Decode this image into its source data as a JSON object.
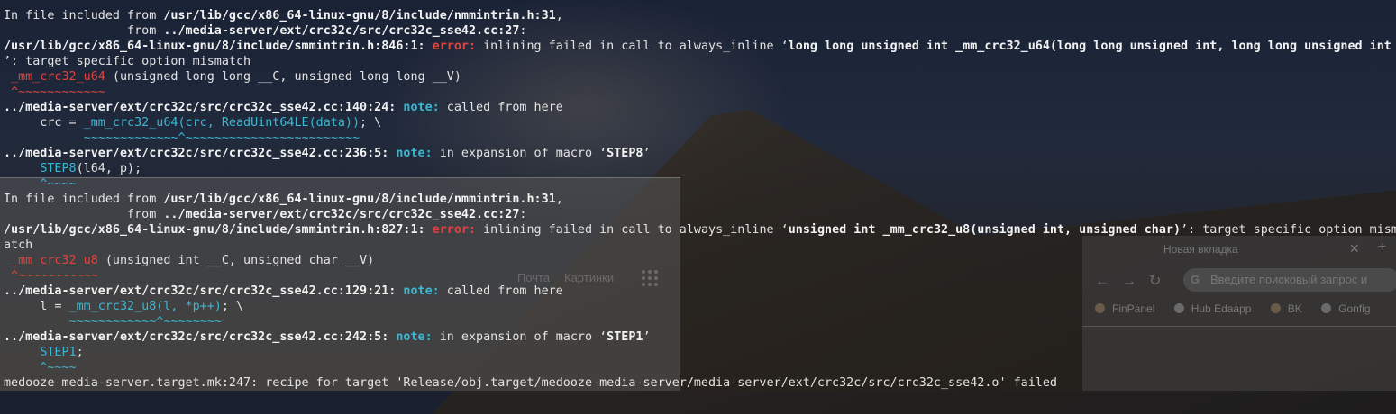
{
  "background_browser": {
    "links": [
      "Почта",
      "Картинки"
    ],
    "tab_title": "Новая вкладка",
    "tab_close": "✕",
    "new_tab": "+",
    "nav": "←→↻",
    "omnibox_icon": "G",
    "omnibox_placeholder": "Введите поисковый запрос и",
    "bookmarks": [
      "FinPanel",
      "Hub Edaapp",
      "BK",
      "Gonfig"
    ]
  },
  "terminal": {
    "colors": {
      "error": "#e0443e",
      "note": "#3bb7d2",
      "text": "#e3e3e3"
    },
    "lines": [
      {
        "s": [
          {
            "t": "In file included from ",
            "c": "plain"
          },
          {
            "t": "/usr/lib/gcc/x86_64-linux-gnu/8/include/nmmintrin.h:31",
            "c": "b"
          },
          {
            "t": ",",
            "c": "plain"
          }
        ]
      },
      {
        "s": [
          {
            "t": "                 from ",
            "c": "plain"
          },
          {
            "t": "../media-server/ext/crc32c/src/crc32c_sse42.cc:27",
            "c": "b"
          },
          {
            "t": ":",
            "c": "plain"
          }
        ]
      },
      {
        "s": [
          {
            "t": "/usr/lib/gcc/x86_64-linux-gnu/8/include/smmintrin.h:846:1:",
            "c": "b"
          },
          {
            "t": " ",
            "c": "plain"
          },
          {
            "t": "error:",
            "c": "err"
          },
          {
            "t": " inlining failed in call to always_inline ‘",
            "c": "plain"
          },
          {
            "t": "long long unsigned int _mm_crc32_u64(long long unsigned int, long long unsigned int",
            "c": "b"
          }
        ]
      },
      {
        "s": [
          {
            "t": "’: target specific option mismatch",
            "c": "plain"
          }
        ]
      },
      {
        "s": [
          {
            "t": " ",
            "c": "plain"
          },
          {
            "t": "_mm_crc32_u64",
            "c": "red"
          },
          {
            "t": " (unsigned long long __C, unsigned long long __V)",
            "c": "plain"
          }
        ]
      },
      {
        "s": [
          {
            "t": " ^~~~~~~~~~~~~",
            "c": "red"
          }
        ]
      },
      {
        "s": [
          {
            "t": "../media-server/ext/crc32c/src/crc32c_sse42.cc:140:24:",
            "c": "b"
          },
          {
            "t": " ",
            "c": "plain"
          },
          {
            "t": "note:",
            "c": "note"
          },
          {
            "t": " called from here",
            "c": "plain"
          }
        ]
      },
      {
        "s": [
          {
            "t": "     crc = ",
            "c": "plain"
          },
          {
            "t": "_mm_crc32_u64(crc, ReadUint64LE(data))",
            "c": "cy"
          },
          {
            "t": "; \\",
            "c": "plain"
          }
        ]
      },
      {
        "s": [
          {
            "t": "           ~~~~~~~~~~~~~^~~~~~~~~~~~~~~~~~~~~~~~~",
            "c": "cy"
          }
        ]
      },
      {
        "s": [
          {
            "t": "../media-server/ext/crc32c/src/crc32c_sse42.cc:236:5:",
            "c": "b"
          },
          {
            "t": " ",
            "c": "plain"
          },
          {
            "t": "note:",
            "c": "note"
          },
          {
            "t": " in expansion of macro ‘",
            "c": "plain"
          },
          {
            "t": "STEP8",
            "c": "b"
          },
          {
            "t": "’",
            "c": "plain"
          }
        ]
      },
      {
        "s": [
          {
            "t": "     ",
            "c": "plain"
          },
          {
            "t": "STEP8",
            "c": "cy"
          },
          {
            "t": "(l64, p);",
            "c": "plain"
          }
        ]
      },
      {
        "s": [
          {
            "t": "     ^~~~~",
            "c": "cy"
          }
        ]
      },
      {
        "s": [
          {
            "t": "In file included from ",
            "c": "plain"
          },
          {
            "t": "/usr/lib/gcc/x86_64-linux-gnu/8/include/nmmintrin.h:31",
            "c": "b"
          },
          {
            "t": ",",
            "c": "plain"
          }
        ]
      },
      {
        "s": [
          {
            "t": "                 from ",
            "c": "plain"
          },
          {
            "t": "../media-server/ext/crc32c/src/crc32c_sse42.cc:27",
            "c": "b"
          },
          {
            "t": ":",
            "c": "plain"
          }
        ]
      },
      {
        "s": [
          {
            "t": "/usr/lib/gcc/x86_64-linux-gnu/8/include/smmintrin.h:827:1:",
            "c": "b"
          },
          {
            "t": " ",
            "c": "plain"
          },
          {
            "t": "error:",
            "c": "err"
          },
          {
            "t": " inlining failed in call to always_inline ‘",
            "c": "plain"
          },
          {
            "t": "unsigned int _mm_crc32_u8(unsigned int, unsigned char)",
            "c": "b"
          },
          {
            "t": "’: target specific option mism",
            "c": "plain"
          }
        ]
      },
      {
        "s": [
          {
            "t": "atch",
            "c": "plain"
          }
        ]
      },
      {
        "s": [
          {
            "t": " ",
            "c": "plain"
          },
          {
            "t": "_mm_crc32_u8",
            "c": "red"
          },
          {
            "t": " (unsigned int __C, unsigned char __V)",
            "c": "plain"
          }
        ]
      },
      {
        "s": [
          {
            "t": " ^~~~~~~~~~~~",
            "c": "red"
          }
        ]
      },
      {
        "s": [
          {
            "t": "../media-server/ext/crc32c/src/crc32c_sse42.cc:129:21:",
            "c": "b"
          },
          {
            "t": " ",
            "c": "plain"
          },
          {
            "t": "note:",
            "c": "note"
          },
          {
            "t": " called from here",
            "c": "plain"
          }
        ]
      },
      {
        "s": [
          {
            "t": "     l = ",
            "c": "plain"
          },
          {
            "t": "_mm_crc32_u8(l, *p++)",
            "c": "cy"
          },
          {
            "t": "; \\",
            "c": "plain"
          }
        ]
      },
      {
        "s": [
          {
            "t": "         ~~~~~~~~~~~~^~~~~~~~~",
            "c": "cy"
          }
        ]
      },
      {
        "s": [
          {
            "t": "../media-server/ext/crc32c/src/crc32c_sse42.cc:242:5:",
            "c": "b"
          },
          {
            "t": " ",
            "c": "plain"
          },
          {
            "t": "note:",
            "c": "note"
          },
          {
            "t": " in expansion of macro ‘",
            "c": "plain"
          },
          {
            "t": "STEP1",
            "c": "b"
          },
          {
            "t": "’",
            "c": "plain"
          }
        ]
      },
      {
        "s": [
          {
            "t": "     ",
            "c": "plain"
          },
          {
            "t": "STEP1",
            "c": "cy"
          },
          {
            "t": ";",
            "c": "plain"
          }
        ]
      },
      {
        "s": [
          {
            "t": "     ^~~~~",
            "c": "cy"
          }
        ]
      },
      {
        "s": [
          {
            "t": "medooze-media-server.target.mk:247: recipe for target 'Release/obj.target/medooze-media-server/media-server/ext/crc32c/src/crc32c_sse42.o' failed",
            "c": "plain"
          }
        ]
      }
    ]
  }
}
